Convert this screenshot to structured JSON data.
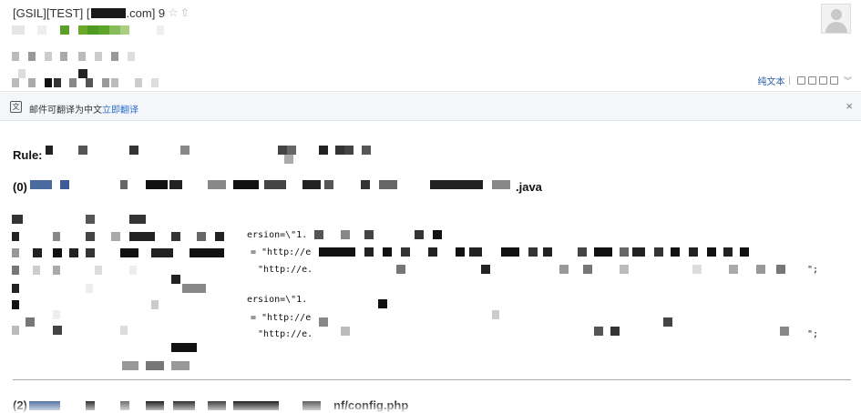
{
  "header": {
    "subject_prefix": "[GSIL][TEST] [",
    "subject_suffix": ".com] 9",
    "star_glyph": "☆",
    "up_glyph": "⇧",
    "toolbar": {
      "plain_text_label": "纯文本",
      "separator": "|"
    }
  },
  "translate_bar": {
    "message": "邮件可翻译为中文",
    "action_label": "立即翻译",
    "close_glyph": "×"
  },
  "body": {
    "rule_label": "Rule:",
    "item0_prefix": "(0)",
    "item0_suffix": ".java",
    "code_frag_1": "ersion=\\\"1.",
    "code_frag_2": "= \"http://e",
    "code_frag_3": "\"http://e.",
    "code_end_1": "\";",
    "code_frag_4": "ersion=\\\"1.",
    "code_frag_5": "= \"http://e",
    "code_frag_6": "\"http://e.",
    "code_end_2": "\";",
    "item2_prefix": "(2)",
    "item2_suffix": "nf/config.php"
  },
  "colors": {
    "link_blue": "#2a6fc9",
    "redaction_dark": "#1a1a1a",
    "redaction_green": "#6aa829",
    "redaction_blue": "#4a6aa0"
  }
}
